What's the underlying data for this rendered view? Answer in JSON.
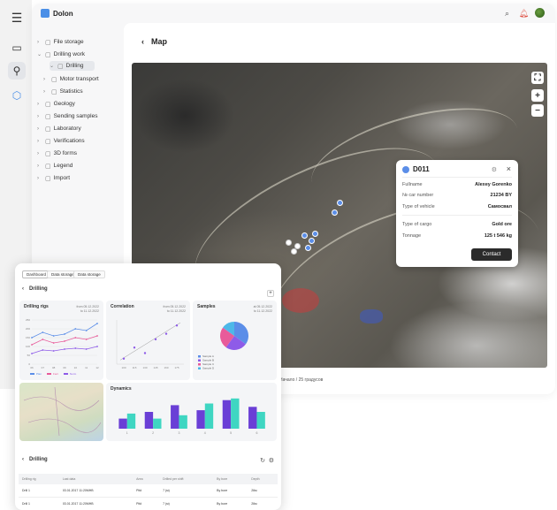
{
  "app": {
    "brand": "Dolon"
  },
  "sidebar": {
    "items": [
      {
        "label": "File storage"
      },
      {
        "label": "Drilling work"
      },
      {
        "label": "Drilling"
      },
      {
        "label": "Motor transport"
      },
      {
        "label": "Statistics"
      },
      {
        "label": "Geology"
      },
      {
        "label": "Sending samples"
      },
      {
        "label": "Laboratory"
      },
      {
        "label": "Verifications"
      },
      {
        "label": "3D forms"
      },
      {
        "label": "Legend"
      },
      {
        "label": "Import"
      }
    ]
  },
  "map": {
    "title": "Map",
    "coords": "Начало / 25 градусов"
  },
  "popup": {
    "id": "D011",
    "rows": [
      {
        "label": "Fullname",
        "value": "Alexey Gorenko"
      },
      {
        "label": "№ car number",
        "value": "21234 BY"
      },
      {
        "label": "Type of vehicle",
        "value": "Самосвал"
      },
      {
        "label": "Type of cargo",
        "value": "Gold ore"
      },
      {
        "label": "Tonnage",
        "value": "125 t 546 kg"
      }
    ],
    "button": "Contact"
  },
  "dashboard": {
    "tabs": [
      "Dashboard",
      "Data storage",
      "Data storage"
    ],
    "title": "Drilling",
    "cards": {
      "rigs": {
        "title": "Drilling rigs",
        "sub1": "from 05.12.2022",
        "sub2": "to 11.12.2022"
      },
      "correlation": {
        "title": "Correlation",
        "sub1": "from 05.12.2022",
        "sub2": "to 11.12.2022"
      },
      "samples": {
        "title": "Samples",
        "sub1": "at 05.12.2022",
        "sub2": "to 11.12.2022"
      },
      "dynamics": {
        "title": "Dynamics"
      }
    },
    "table_title": "Drilling",
    "table": {
      "headers": [
        "Drilling rig",
        "Last data",
        "Area",
        "Drilled per shift",
        "By bore",
        "Depth"
      ],
      "rows": [
        [
          "Drill 1",
          "03.01.2017 11:20МНВ",
          "Pit#",
          "7 (м)",
          "By bore",
          "26м"
        ],
        [
          "Drill 1",
          "03.01.2017 11:20МНВ",
          "Pit#",
          "7 (м)",
          "By bore",
          "26м"
        ]
      ]
    }
  },
  "chart_data": [
    {
      "type": "line",
      "title": "Drilling rigs",
      "categories": [
        "06",
        "07",
        "08",
        "09",
        "10",
        "11",
        "12"
      ],
      "series": [
        {
          "name": "Plan",
          "values": [
            150,
            180,
            160,
            170,
            200,
            190,
            230
          ]
        },
        {
          "name": "Fact",
          "values": [
            110,
            140,
            120,
            130,
            150,
            140,
            160
          ]
        },
        {
          "name": "Norm",
          "values": [
            60,
            80,
            75,
            85,
            90,
            85,
            100
          ]
        }
      ],
      "ylim": [
        0,
        250
      ]
    },
    {
      "type": "scatter",
      "title": "Correlation",
      "x": [
        100,
        115,
        130,
        145,
        160,
        175
      ],
      "y": [
        120,
        160,
        140,
        190,
        210,
        240
      ]
    },
    {
      "type": "pie",
      "title": "Samples",
      "labels": [
        "Sample A",
        "Sample B",
        "Sample C",
        "Sample D"
      ],
      "values": [
        35,
        25,
        25,
        15
      ],
      "colors": [
        "#5b8ee8",
        "#8e5be8",
        "#e85b9a",
        "#4db8e8"
      ]
    },
    {
      "type": "bar",
      "title": "Dynamics",
      "categories": [
        "1",
        "2",
        "3",
        "4",
        "5",
        "6"
      ],
      "series": [
        {
          "name": "A",
          "values": [
            6,
            10,
            14,
            11,
            17,
            13
          ]
        },
        {
          "name": "B",
          "values": [
            9,
            6,
            8,
            15,
            18,
            10
          ]
        }
      ]
    }
  ]
}
